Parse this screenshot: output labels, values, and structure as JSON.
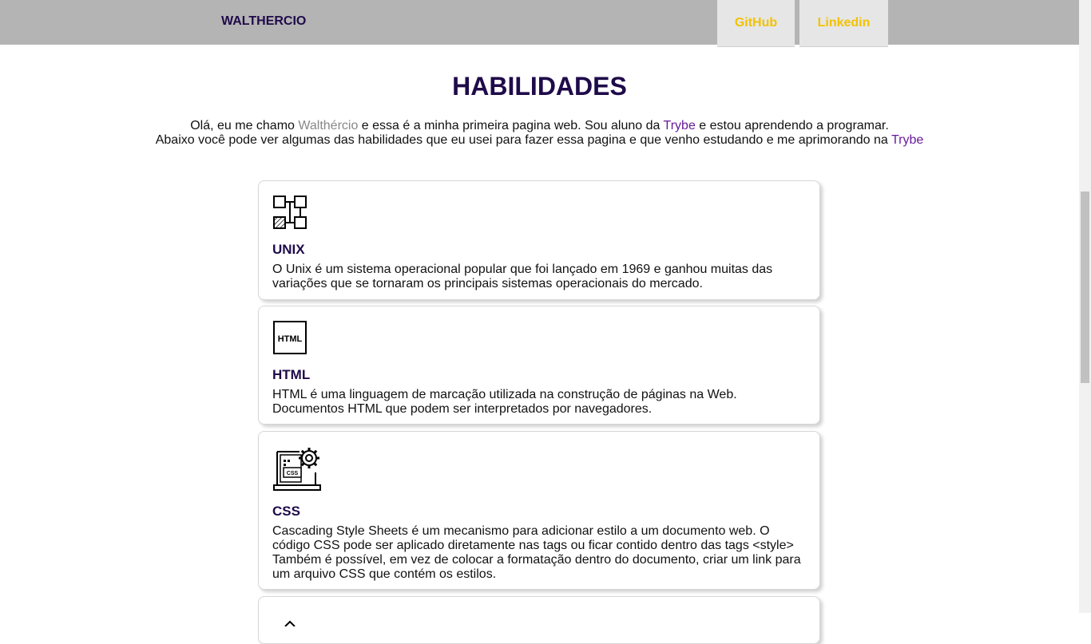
{
  "header": {
    "brand": "WALTHERCIO",
    "links": [
      {
        "label": "GitHub"
      },
      {
        "label": "Linkedin"
      }
    ]
  },
  "main": {
    "title": "HABILIDADES",
    "intro_line1": {
      "pre": "Olá, eu me chamo ",
      "name": "Walthércio",
      "mid": " e essa é a minha primeira pagina web. Sou aluno da ",
      "trybe": "Trybe",
      "post": " e estou aprendendo a programar."
    },
    "intro_line2": {
      "pre": "Abaixo você pode ver algumas das habilidades que eu usei para fazer essa pagina e que venho estudando e me aprimorando na ",
      "trybe": "Trybe"
    },
    "skills": [
      {
        "title": "UNIX",
        "icon": "network-diagram-icon",
        "description": "O Unix é um sistema operacional popular que foi lançado em 1969 e ganhou muitas das variações que se tornaram os principais sistemas operacionais do mercado."
      },
      {
        "title": "HTML",
        "icon": "html-file-icon",
        "icon_text": "HTML",
        "description": "HTML é uma linguagem de marcação utilizada na construção de páginas na Web. Documentos HTML que podem ser interpretados por navegadores."
      },
      {
        "title": "CSS",
        "icon": "css-laptop-gear-icon",
        "icon_text": "CSS",
        "description": "Cascading Style Sheets é um mecanismo para adicionar estilo a um documento web. O código CSS pode ser aplicado diretamente nas tags ou ficar contido dentro das tags <style> Também é possível, em vez de colocar a formatação dentro do documento, criar um link para um arquivo CSS que contém os estilos."
      }
    ]
  },
  "colors": {
    "header_bg": "#b4b4b4",
    "brand": "#1f0b4a",
    "nav_link": "#f2c200",
    "nav_bg": "#e6e6e6",
    "trybe_link": "#6a1b9a",
    "name_text": "#888888"
  }
}
